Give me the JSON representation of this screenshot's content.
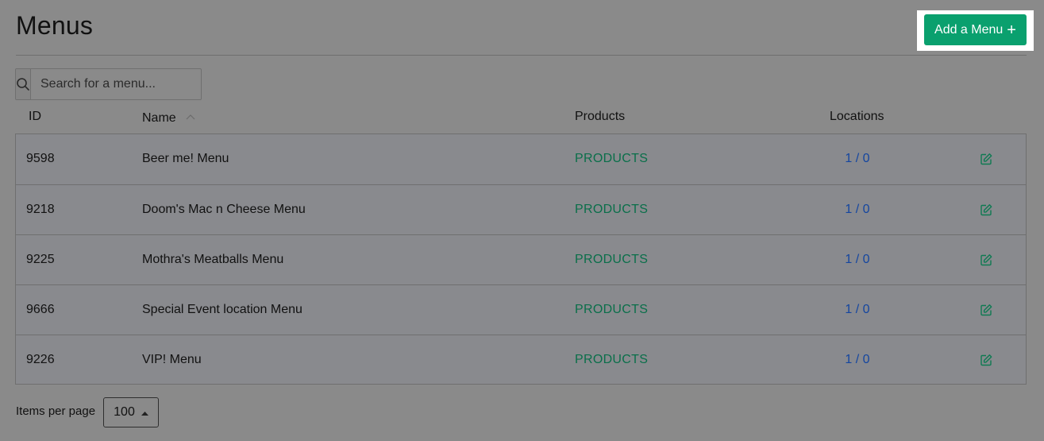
{
  "header": {
    "title": "Menus",
    "add_button_label": "Add a Menu",
    "add_button_icon": "plus-icon"
  },
  "search": {
    "placeholder": "Search for a menu...",
    "value": "",
    "icon": "search-icon"
  },
  "table": {
    "columns": [
      "ID",
      "Name",
      "Products",
      "Locations"
    ],
    "sorted_column": "Name",
    "sort_direction": "ascending",
    "rows": [
      {
        "id": "9598",
        "name": "Beer me! Menu",
        "products": "PRODUCTS",
        "locations": "1 / 0"
      },
      {
        "id": "9218",
        "name": "Doom's Mac n Cheese Menu",
        "products": "PRODUCTS",
        "locations": "1 / 0"
      },
      {
        "id": "9225",
        "name": "Mothra's Meatballs Menu",
        "products": "PRODUCTS",
        "locations": "1 / 0"
      },
      {
        "id": "9666",
        "name": "Special Event location Menu",
        "products": "PRODUCTS",
        "locations": "1 / 0"
      },
      {
        "id": "9226",
        "name": "VIP! Menu",
        "products": "PRODUCTS",
        "locations": "1 / 0"
      }
    ]
  },
  "pagination": {
    "items_per_page_label": "Items per page",
    "items_per_page_value": "100"
  },
  "colors": {
    "accent": "#0aa06e",
    "products_link": "#0a6f4a",
    "locations_link": "#1446a0"
  }
}
